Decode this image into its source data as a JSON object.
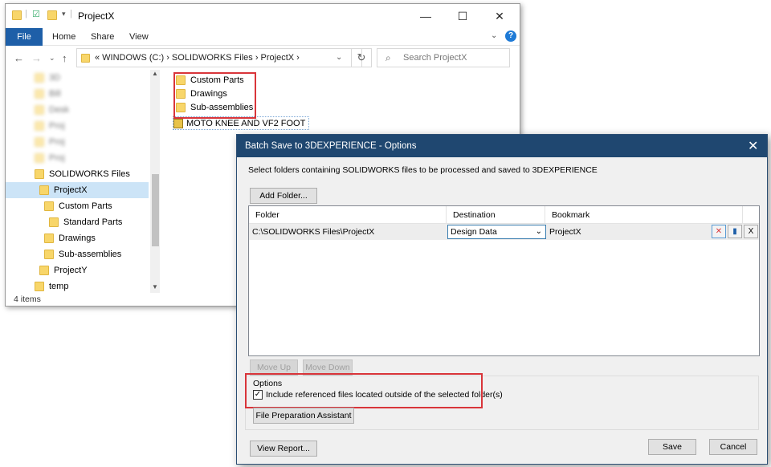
{
  "explorer": {
    "title": "ProjectX",
    "window_controls": {
      "minimize": "—",
      "maximize": "☐",
      "close": "✕"
    },
    "ribbon_tabs": [
      "File",
      "Home",
      "Share",
      "View"
    ],
    "address": {
      "segments": "«  WINDOWS (C:)  ›  SOLIDWORKS Files  ›  ProjectX  ›"
    },
    "search_placeholder": "Search ProjectX",
    "nav_items_blurred": [
      "3D",
      "Bill",
      "Desk",
      "Proj",
      "Proj",
      "Proj"
    ],
    "nav_items": [
      "SOLIDWORKS Files",
      "ProjectX",
      "Custom Parts",
      "Standard Parts",
      "Drawings",
      "Sub-assemblies",
      "ProjectY",
      "temp"
    ],
    "files": [
      "Custom Parts",
      "Drawings",
      "Sub-assemblies",
      "MOTO KNEE AND VF2 FOOT"
    ],
    "status": "4 items"
  },
  "dialog": {
    "title": "Batch Save to 3DEXPERIENCE - Options",
    "description": "Select folders containing SOLIDWORKS files to be processed and saved to 3DEXPERIENCE",
    "add_folder": "Add Folder...",
    "columns": [
      "Folder",
      "Destination",
      "Bookmark"
    ],
    "row": {
      "folder": "C:\\SOLIDWORKS Files\\ProjectX",
      "destination": "Design Data",
      "bookmark": "ProjectX"
    },
    "move_up": "Move Up",
    "move_down": "Move Down",
    "options_label": "Options",
    "checkbox_label": "Include referenced files located outside of the selected folder(s)",
    "checkbox_checked": true,
    "file_prep": "File Preparation Assistant",
    "view_report": "View Report...",
    "save": "Save",
    "cancel": "Cancel"
  },
  "colors": {
    "accent": "#1e5fa8",
    "dialog_title": "#1f4770",
    "highlight": "#d9353a",
    "folder": "#f8d66a"
  }
}
